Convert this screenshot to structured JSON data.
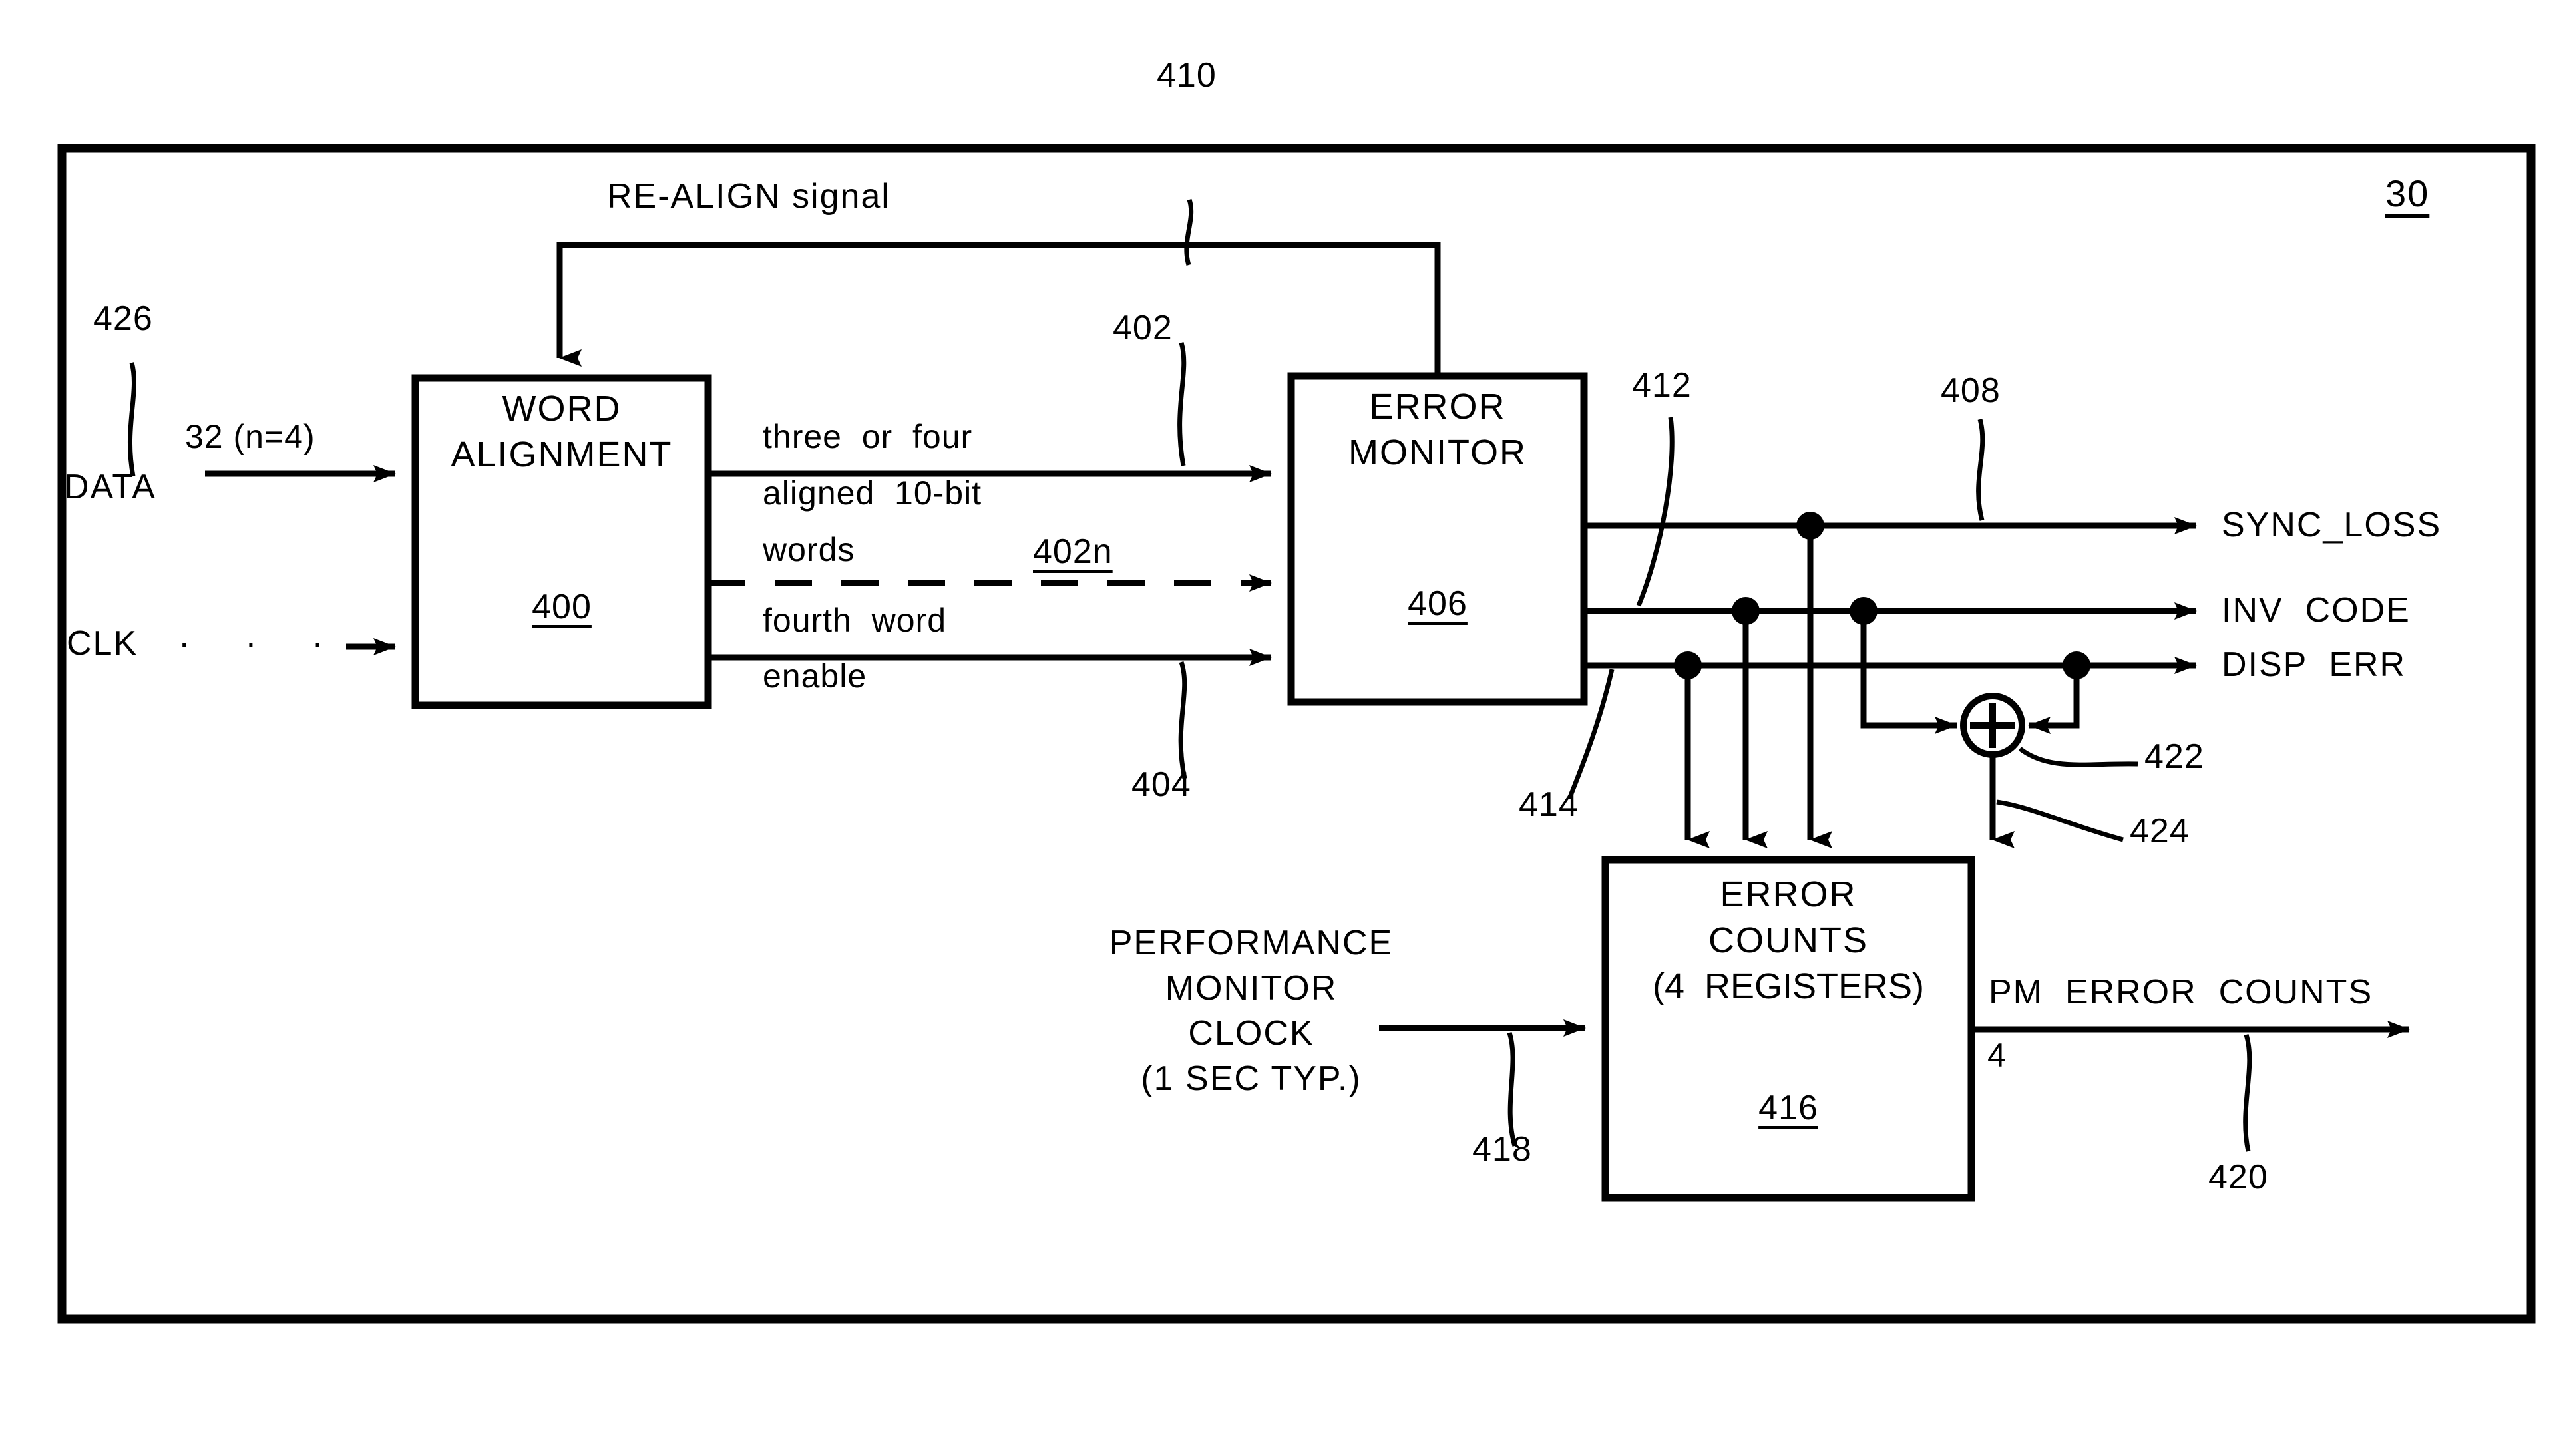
{
  "figure": {
    "outer_frame_ref": "30",
    "blocks": [
      {
        "id": "word-alignment",
        "title_line1": "WORD",
        "title_line2": "ALIGNMENT",
        "ref": "400"
      },
      {
        "id": "error-monitor",
        "title_line1": "ERROR",
        "title_line2": "MONITOR",
        "ref": "406"
      },
      {
        "id": "error-counts",
        "title_line1": "ERROR",
        "title_line2": "COUNTS",
        "title_line3": "(4  REGISTERS)",
        "ref": "416"
      }
    ],
    "inputs": {
      "data_label": "DATA",
      "data_bus_label": "32 (n=4)",
      "data_ref": "426",
      "clk_label": "CLK",
      "clk_dots": "·  ·  ·  ·",
      "pm_clock_line1": "PERFORMANCE",
      "pm_clock_line2": "MONITOR",
      "pm_clock_line3": "CLOCK",
      "pm_clock_line4": "(1 SEC TYP.)",
      "pm_clock_ref": "418"
    },
    "internal_signals": {
      "realign_label": "RE-ALIGN signal",
      "realign_ref": "410",
      "aligned_words_line1": "three  or  four",
      "aligned_words_line2": "aligned  10-bit",
      "aligned_words_line3": "words",
      "aligned_words_ref": "402",
      "aligned_words_ref_n": "402n",
      "fourth_word_line1": "fourth  word",
      "fourth_word_line2": "enable",
      "fourth_word_ref": "404",
      "output_bus_ref_412": "412",
      "output_bus_ref_414": "414",
      "sum_node_ref": "422",
      "sum_output_ref": "424",
      "sum_symbol": "+"
    },
    "outputs": {
      "sync_loss": "SYNC_LOSS",
      "sync_loss_ref": "408",
      "inv_code": "INV  CODE",
      "disp_err": "DISP  ERR",
      "pm_error_counts": "PM  ERROR  COUNTS",
      "pm_error_counts_width": "4",
      "pm_error_counts_ref": "420"
    },
    "colors": {
      "ink": "#000000",
      "paper": "#ffffff"
    }
  }
}
